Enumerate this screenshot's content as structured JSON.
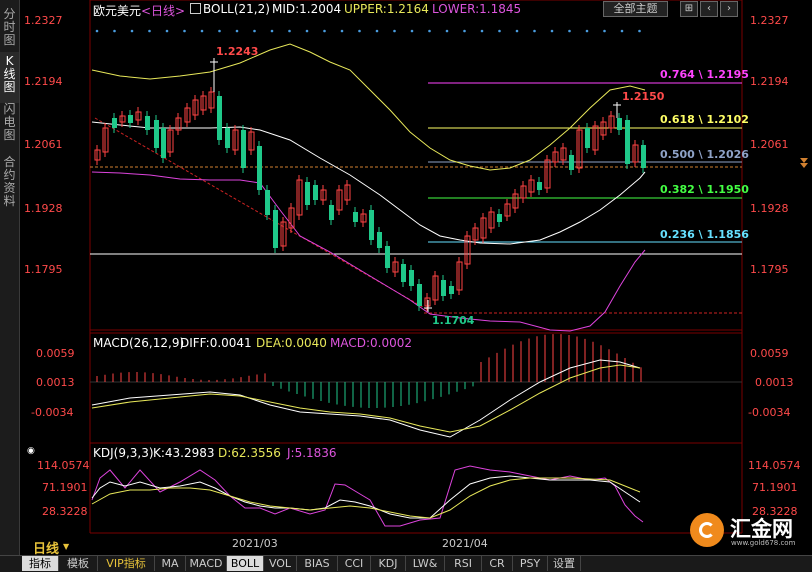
{
  "sidebar": {
    "tabs": [
      {
        "label": "分时图",
        "active": false
      },
      {
        "label": "K线图",
        "active": true
      },
      {
        "label": "闪电图",
        "active": false
      },
      {
        "label": "合约资料",
        "active": false
      }
    ]
  },
  "header": {
    "symbol": "欧元美元",
    "period_tag": "<日线>",
    "indicator": "BOLL(21,2)",
    "mid": "MID:1.2004",
    "upper": "UPPER:1.2164",
    "lower": "LOWER:1.1845",
    "theme_button": "全部主题",
    "tool_buttons": [
      "⊞",
      "‹",
      "›"
    ]
  },
  "main_axis": {
    "ticks": [
      "1.2327",
      "1.2194",
      "1.2061",
      "1.1928",
      "1.1795"
    ]
  },
  "annotations": {
    "high": "1.2243",
    "recent_high": "1.2150",
    "low": "1.1704"
  },
  "fibonacci": [
    {
      "label": "0.764 \\ 1.2195",
      "color": "#ff44ff"
    },
    {
      "label": "0.618 \\ 1.2102",
      "color": "#ffff66"
    },
    {
      "label": "0.500 \\ 1.2026",
      "color": "#8fa3c8"
    },
    {
      "label": "0.382 \\ 1.1950",
      "color": "#44ff44"
    },
    {
      "label": "0.236 \\ 1.1856",
      "color": "#66e0ff"
    }
  ],
  "macd": {
    "title": "MACD(26,12,9)",
    "diff": "DIFF:0.0041",
    "dea": "DEA:0.0040",
    "macd": "MACD:0.0002",
    "ticks": [
      "0.0059",
      "0.0013",
      "-0.0034"
    ]
  },
  "kdj": {
    "title": "KDJ(9,3,3)",
    "k": "K:43.2983",
    "d": "D:62.3556",
    "j": "J:5.1836",
    "ticks": [
      "114.0574",
      "71.1901",
      "28.3228"
    ]
  },
  "x_axis": {
    "dates": [
      "2021/03",
      "2021/04"
    ]
  },
  "period_selector": {
    "label": "日线",
    "caret": "▼"
  },
  "bottom_tabs": [
    "指标",
    "模板",
    "VIP指标",
    "MA",
    "MACD",
    "BOLL",
    "VOL",
    "BIAS",
    "CCI",
    "KDJ",
    "LW&",
    "RSI",
    "CR",
    "PSY",
    "设置"
  ],
  "logo": {
    "text": "汇金网",
    "url": "www.gold678.com"
  },
  "colors": {
    "up": "#ff4444",
    "down": "#1fc98a",
    "mid_band": "#ffffff",
    "upper_band": "#e8e85a",
    "lower_band": "#dd44dd",
    "axis_label": "#ff4a4a"
  }
}
